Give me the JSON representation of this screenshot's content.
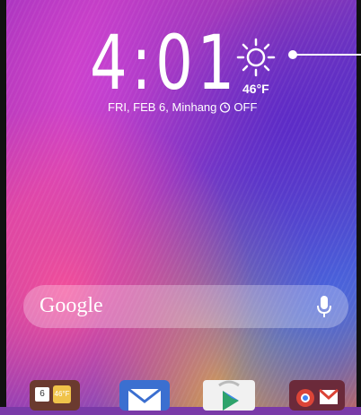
{
  "clock": {
    "time": "4:01"
  },
  "weather": {
    "temperature": "46°F",
    "icon": "sun-icon"
  },
  "date_row": {
    "date_location": "FRI, FEB 6, Minhang",
    "alarm_status": "OFF"
  },
  "search": {
    "label": "Google",
    "mic_icon": "microphone-icon"
  },
  "dock": {
    "calendar_day": "6",
    "calendar_weather": "46°F",
    "apps": [
      "calendar-weather-widget",
      "email-app",
      "play-store-app",
      "chrome-gmail-folder"
    ]
  }
}
